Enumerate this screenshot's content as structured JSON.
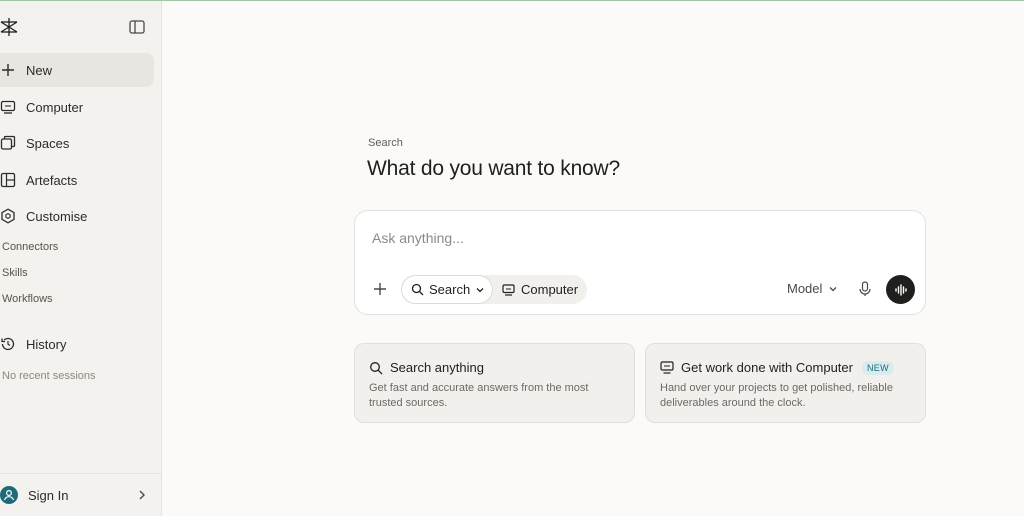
{
  "sidebar": {
    "nav": [
      {
        "label": "New",
        "icon": "plus-icon"
      },
      {
        "label": "Computer",
        "icon": "computer-icon"
      },
      {
        "label": "Spaces",
        "icon": "spaces-icon"
      },
      {
        "label": "Artefacts",
        "icon": "artefacts-icon"
      },
      {
        "label": "Customise",
        "icon": "customise-icon"
      }
    ],
    "sub": [
      "Connectors",
      "Skills",
      "Workflows"
    ],
    "history_label": "History",
    "history_empty": "No recent sessions",
    "signin_label": "Sign In"
  },
  "main": {
    "eyebrow": "Search",
    "headline": "What do you want to know?",
    "ask": {
      "placeholder": "Ask anything...",
      "search_mode": "Search",
      "computer_mode": "Computer",
      "model_label": "Model"
    },
    "cards": [
      {
        "title": "Search anything",
        "line1": "Get fast and accurate answers from the most",
        "line2": "trusted sources."
      },
      {
        "title": "Get work done with Computer",
        "badge": "NEW",
        "line1": "Hand over your projects to get polished, reliable",
        "line2": "deliverables around the clock."
      }
    ]
  },
  "colors": {
    "accent": "#1d6b78",
    "background": "#fbfaf8",
    "sidebar": "#f3f2ee"
  }
}
